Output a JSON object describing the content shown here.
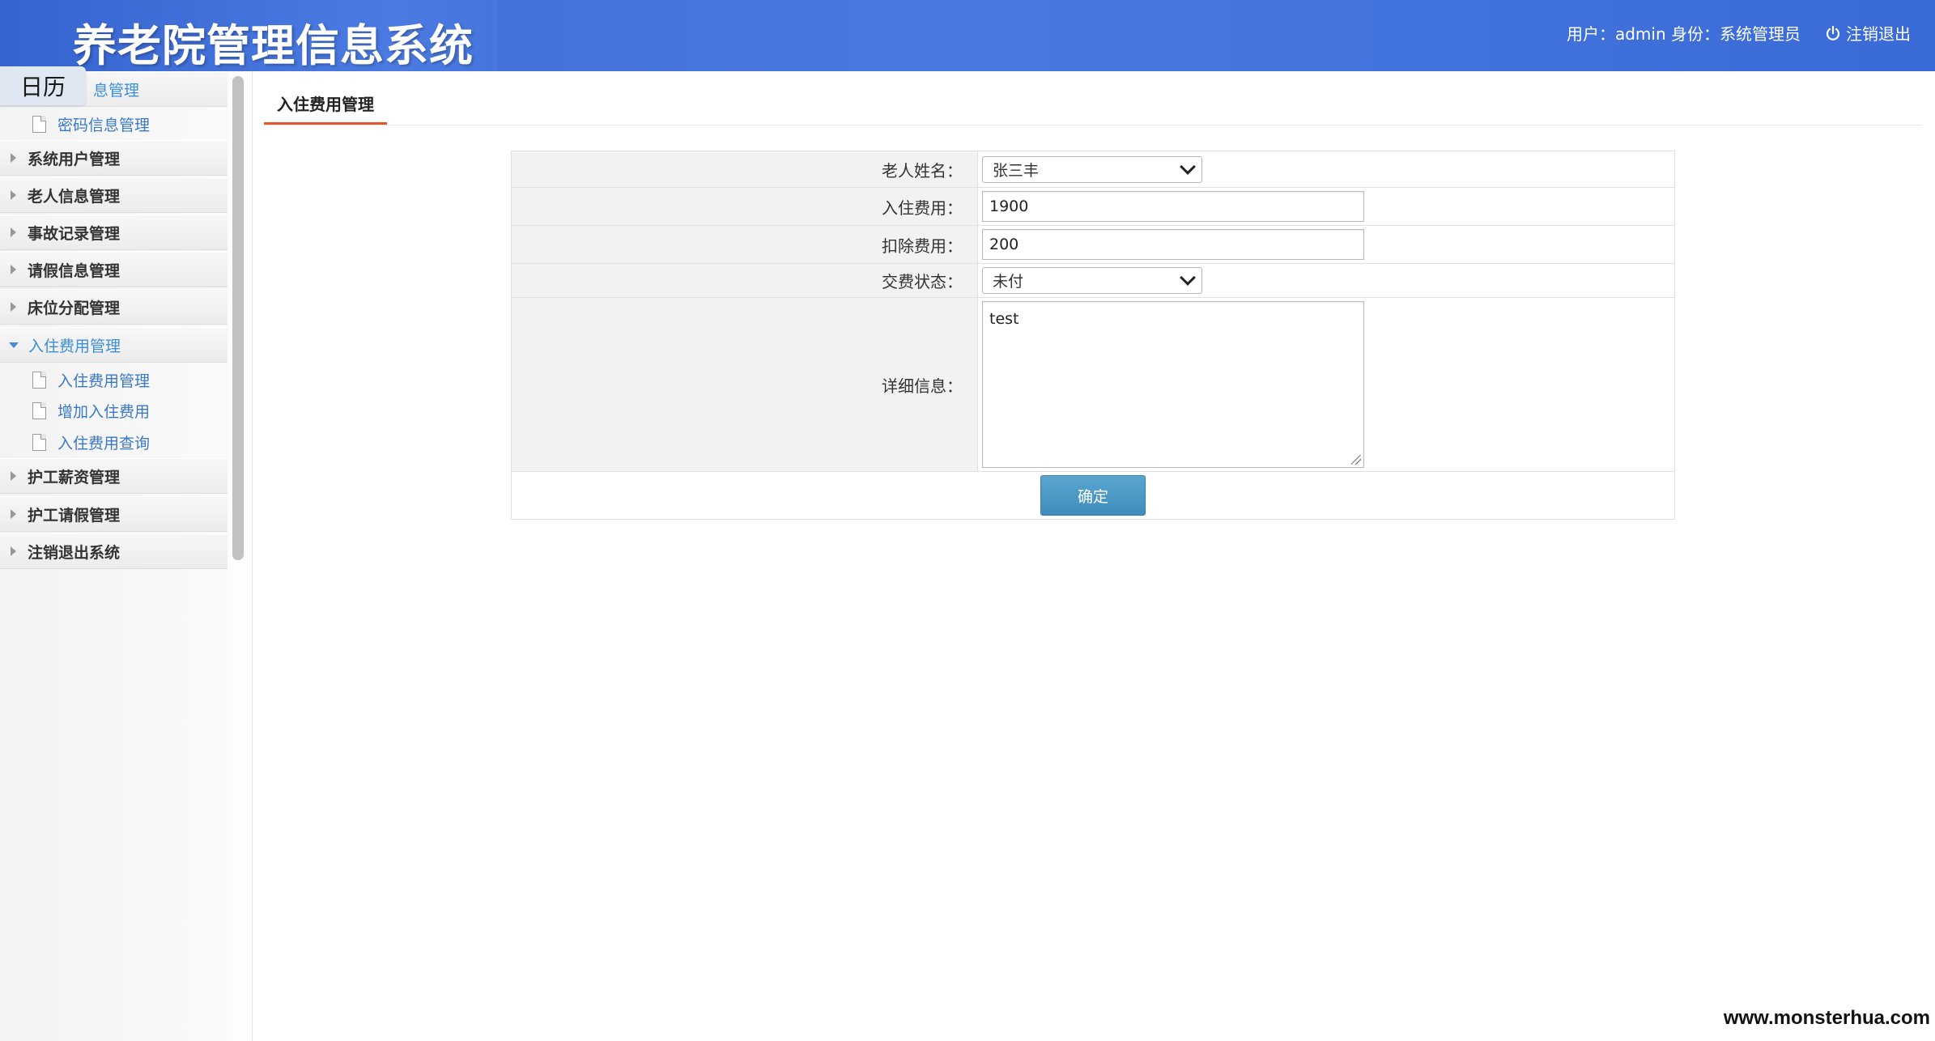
{
  "header": {
    "app_title": "养老院管理信息系统",
    "user_info": "用户：admin 身份：系统管理员",
    "logout_label": "注销退出",
    "logout_icon": "power-icon",
    "background_color": "#4474dc"
  },
  "calendar_badge": "日历",
  "sidebar": {
    "top_group_partial": "息管理",
    "password_item": "密码信息管理",
    "groups": [
      {
        "label": "系统用户管理"
      },
      {
        "label": "老人信息管理"
      },
      {
        "label": "事故记录管理"
      },
      {
        "label": "请假信息管理"
      },
      {
        "label": "床位分配管理"
      },
      {
        "label": "入住费用管理",
        "expanded": true
      },
      {
        "label": "护工薪资管理"
      },
      {
        "label": "护工请假管理"
      },
      {
        "label": "注销退出系统"
      }
    ],
    "sub_items": [
      "入住费用管理",
      "增加入住费用",
      "入住费用查询"
    ],
    "active_color": "#3b8ed8"
  },
  "tab": {
    "label": "入住费用管理",
    "underline_color": "#e4552d"
  },
  "form": {
    "elder_name_label": "老人姓名：",
    "elder_name_value": "张三丰",
    "fee_label": "入住费用：",
    "fee_value": "1900",
    "deduction_label": "扣除费用：",
    "deduction_value": "200",
    "status_label": "交费状态：",
    "status_value": "未付",
    "details_label": "详细信息：",
    "details_value": "test",
    "submit_label": "确定"
  },
  "watermark": "www.monsterhua.com"
}
